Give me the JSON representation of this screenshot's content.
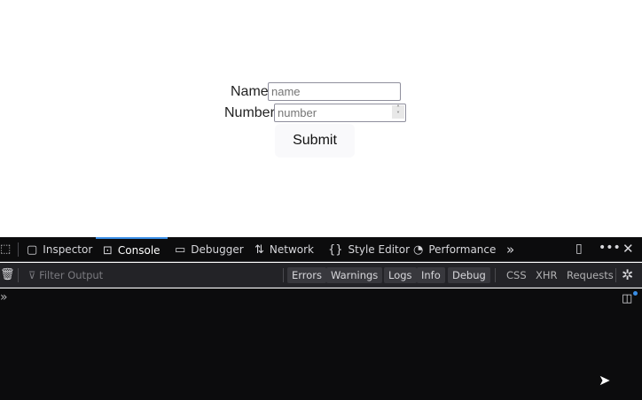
{
  "form": {
    "name_label": "Name",
    "name_placeholder": "name",
    "number_label": "Number",
    "number_placeholder": "number",
    "submit_label": "Submit"
  },
  "devtools": {
    "tabs": [
      {
        "label": "Inspector",
        "icon": "inspector-icon"
      },
      {
        "label": "Console",
        "icon": "console-icon"
      },
      {
        "label": "Debugger",
        "icon": "debugger-icon"
      },
      {
        "label": "Network",
        "icon": "network-icon"
      },
      {
        "label": "Style Editor",
        "icon": "style-editor-icon"
      },
      {
        "label": "Performance",
        "icon": "performance-icon"
      }
    ],
    "filter_placeholder": "Filter Output",
    "levels": [
      "Errors",
      "Warnings",
      "Logs",
      "Info",
      "Debug"
    ],
    "types": [
      "CSS",
      "XHR",
      "Requests"
    ],
    "accent": "#3a8ee6"
  }
}
